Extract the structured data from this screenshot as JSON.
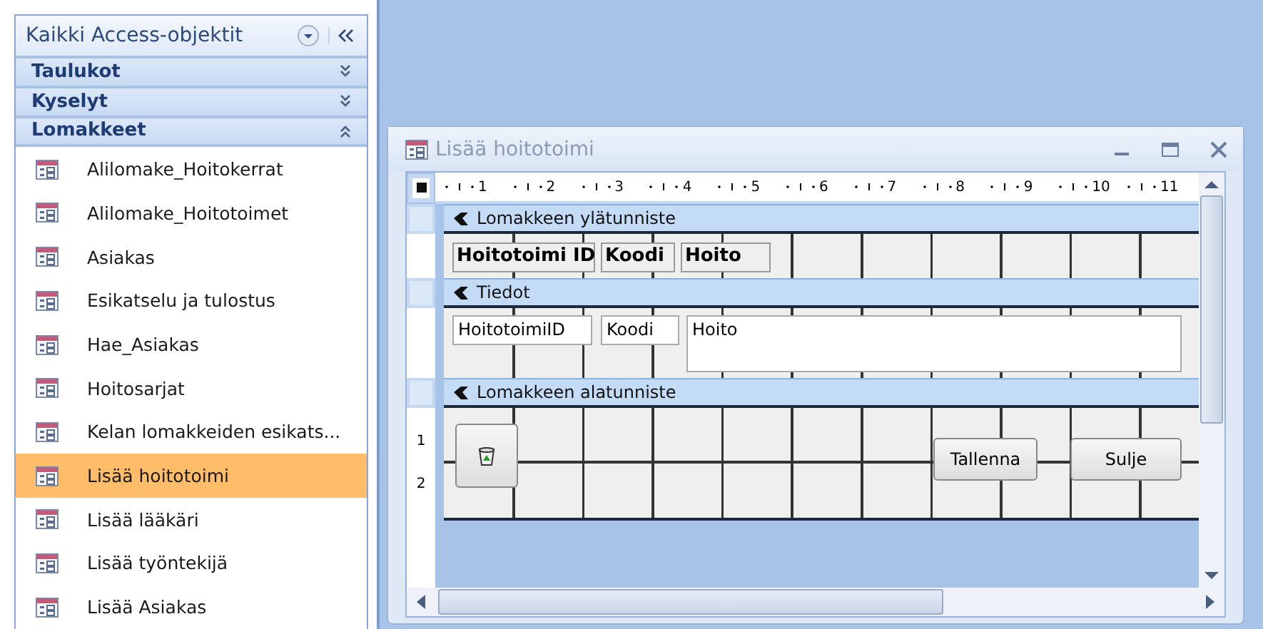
{
  "nav": {
    "title": "Kaikki Access-objektit",
    "groups": [
      {
        "label": "Taulukot",
        "expanded": false
      },
      {
        "label": "Kyselyt",
        "expanded": false
      },
      {
        "label": "Lomakkeet",
        "expanded": true
      }
    ],
    "items": [
      {
        "label": "Alilomake_Hoitokerrat",
        "selected": false
      },
      {
        "label": "Alilomake_Hoitotoimet",
        "selected": false
      },
      {
        "label": "Asiakas",
        "selected": false
      },
      {
        "label": "Esikatselu ja tulostus",
        "selected": false
      },
      {
        "label": "Hae_Asiakas",
        "selected": false
      },
      {
        "label": "Hoitosarjat",
        "selected": false
      },
      {
        "label": "Kelan lomakkeiden esikats...",
        "selected": false
      },
      {
        "label": "Lisää hoitotoimi",
        "selected": true
      },
      {
        "label": "Lisää lääkäri",
        "selected": false
      },
      {
        "label": "Lisää työntekijä",
        "selected": false
      },
      {
        "label": "Lisää  Asiakas",
        "selected": false
      }
    ]
  },
  "form_window": {
    "title": "Lisää hoitotoimi",
    "ruler_marks": [
      "1",
      "2",
      "3",
      "4",
      "5",
      "6",
      "7",
      "8",
      "9",
      "10",
      "11"
    ],
    "vertical_ruler_marks": [
      "1",
      "2"
    ],
    "sections": [
      {
        "title": "Lomakkeen ylätunniste",
        "controls": [
          {
            "kind": "label",
            "text": "Hoitotoimi ID"
          },
          {
            "kind": "label",
            "text": "Koodi"
          },
          {
            "kind": "label",
            "text": "Hoito"
          }
        ]
      },
      {
        "title": "Tiedot",
        "controls": [
          {
            "kind": "textbox",
            "text": "HoitotoimiID"
          },
          {
            "kind": "textbox",
            "text": "Koodi"
          },
          {
            "kind": "textbox",
            "text": "Hoito"
          }
        ]
      },
      {
        "title": "Lomakkeen alatunniste",
        "controls": [
          {
            "kind": "icon-button"
          },
          {
            "kind": "button",
            "text": "Tallenna"
          },
          {
            "kind": "button",
            "text": "Sulje"
          }
        ]
      }
    ]
  }
}
